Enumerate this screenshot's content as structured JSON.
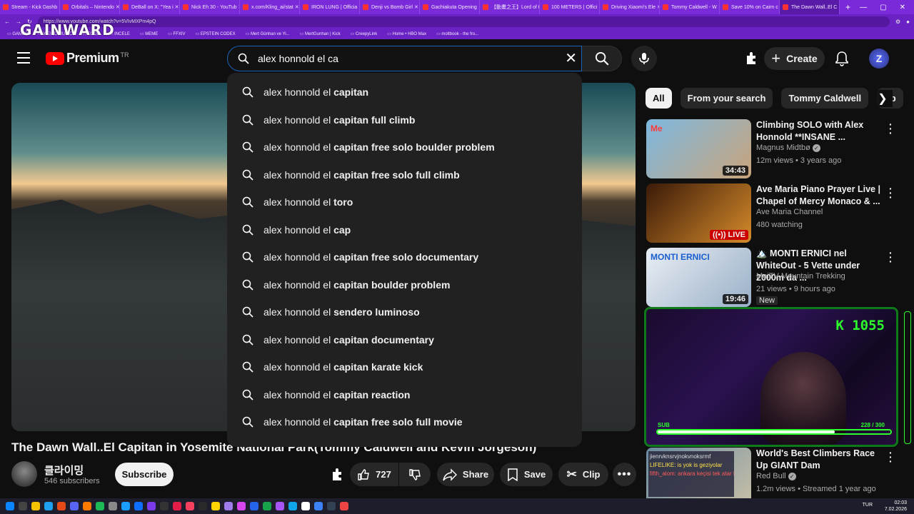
{
  "browser": {
    "tabs": [
      "Stream - Kick Dashb",
      "Orbitals – Nintendo",
      "DeBall on X: \"Yea i",
      "Nick Eh 30 - YouTub",
      "x.com/Kling_ai/stat",
      "IRON LUNG | Officia",
      "Denji vs Bomb Girl",
      "Gachiakuta Opening",
      "【動畫之王】Lord of t",
      "100 METERS | Offici",
      "Driving Xiaomi's Ele",
      "Tommy Caldwell - W",
      "Save 10% on Cairn c",
      "The Dawn Wall..El C"
    ],
    "active_tab": 13,
    "new_tab": "+",
    "url": "https://www.youtube.com/watch?v=5VIvMXPm4pQ",
    "bookmarks": [
      "GAMES",
      "WEIRD MUSIC",
      "TOOL",
      "INCELE",
      "MEME",
      "FFXIV",
      "EPSTEIN CODEX",
      "Mert Günhan ve Yi...",
      "MertGunhan | Kick",
      "CreepyLink",
      "Home • HBO Max",
      "moltbook - the fro..."
    ],
    "window_controls": [
      "—",
      "▢",
      "✕"
    ]
  },
  "overlay": {
    "watermark": "GAINWARD"
  },
  "header": {
    "logo_text": "Premium",
    "logo_region": "TR",
    "search_query": "alex honnold el ca",
    "create_label": "Create",
    "avatar_letter": "Z"
  },
  "suggestions": [
    {
      "prefix": "alex honnold el ",
      "bold": "capitan"
    },
    {
      "prefix": "alex honnold el ",
      "bold": "capitan full climb"
    },
    {
      "prefix": "alex honnold el ",
      "bold": "capitan free solo boulder problem"
    },
    {
      "prefix": "alex honnold el ",
      "bold": "capitan free solo full climb"
    },
    {
      "prefix": "alex honnold el ",
      "bold": "toro"
    },
    {
      "prefix": "alex honnold el ",
      "bold": "cap"
    },
    {
      "prefix": "alex honnold el ",
      "bold": "capitan free solo documentary"
    },
    {
      "prefix": "alex honnold el ",
      "bold": "capitan boulder problem"
    },
    {
      "prefix": "alex honnold el ",
      "bold": "sendero luminoso"
    },
    {
      "prefix": "alex honnold el ",
      "bold": "capitan documentary"
    },
    {
      "prefix": "alex honnold el ",
      "bold": "capitan karate kick"
    },
    {
      "prefix": "alex honnold el ",
      "bold": "capitan reaction"
    },
    {
      "prefix": "alex honnold el ",
      "bold": "capitan free solo full movie"
    }
  ],
  "video": {
    "title": "The Dawn Wall..El Capitan in Yosemite National Park(Tommy Caldwell and Kevin Jorgeson)",
    "channel": "클라이밍",
    "subscribers": "546 subscribers",
    "subscribe_label": "Subscribe",
    "likes": "727",
    "share_label": "Share",
    "save_label": "Save",
    "clip_label": "Clip"
  },
  "chips": [
    "All",
    "From your search",
    "Tommy Caldwell",
    "Sp"
  ],
  "recommendations": [
    {
      "title": "Climbing SOLO with Alex Honnold   **INSANE ...",
      "channel": "Magnus Midtbø",
      "verified": true,
      "meta": "12m views • 3 years ago",
      "badge": "34:43",
      "badge_type": "duration",
      "thumb_text": "Me",
      "colors": [
        "#7cb8e0",
        "#c9a37a"
      ]
    },
    {
      "title": "Ave Maria Piano Prayer Live | Chapel of Mercy Monaco & ...",
      "channel": "Ave Maria Channel",
      "verified": false,
      "meta": "480 watching",
      "badge": "LIVE",
      "badge_type": "live",
      "thumb_text": "",
      "colors": [
        "#3a1a08",
        "#d58a2a"
      ]
    },
    {
      "title": "🏔️ MONTI ERNICI nel WhiteOut - 5 Vette under 2000m da ...",
      "channel": "MeiTV Mountain Trekking",
      "verified": false,
      "meta": "21 views • 9 hours ago",
      "extra": "New",
      "badge": "19:46",
      "badge_type": "duration",
      "thumb_text": "MONTI ERNICI",
      "colors": [
        "#e9eef4",
        "#9ab0c8"
      ]
    },
    {
      "title": "World's Best Climbers Race Up GIANT Dam",
      "channel": "Red Bull",
      "verified": true,
      "meta": "1.2m views • Streamed 1 year ago",
      "badge": "",
      "badge_type": "none",
      "thumb_text": "",
      "colors": [
        "#6a8aa0",
        "#c8c0a8"
      ]
    }
  ],
  "stream_overlay": {
    "kick_count": "K 1055",
    "sub_label": "SUB",
    "sub_count": "228 / 300",
    "sub_progress": 0.76,
    "chat_lines": [
      "jienrvknsrvjnokvnoksrmf",
      "LIFELIKE: is yok is geziyolar",
      "fifth_alom: ankara keçisi tek atar bunlara"
    ]
  },
  "taskbar": {
    "language": "TUR",
    "time": "02:03",
    "date": "7.02.2026"
  },
  "colors": {
    "browser_chrome": "#7a2ad8",
    "yt_red": "#ff0000",
    "accent_green": "#2cff2c"
  }
}
